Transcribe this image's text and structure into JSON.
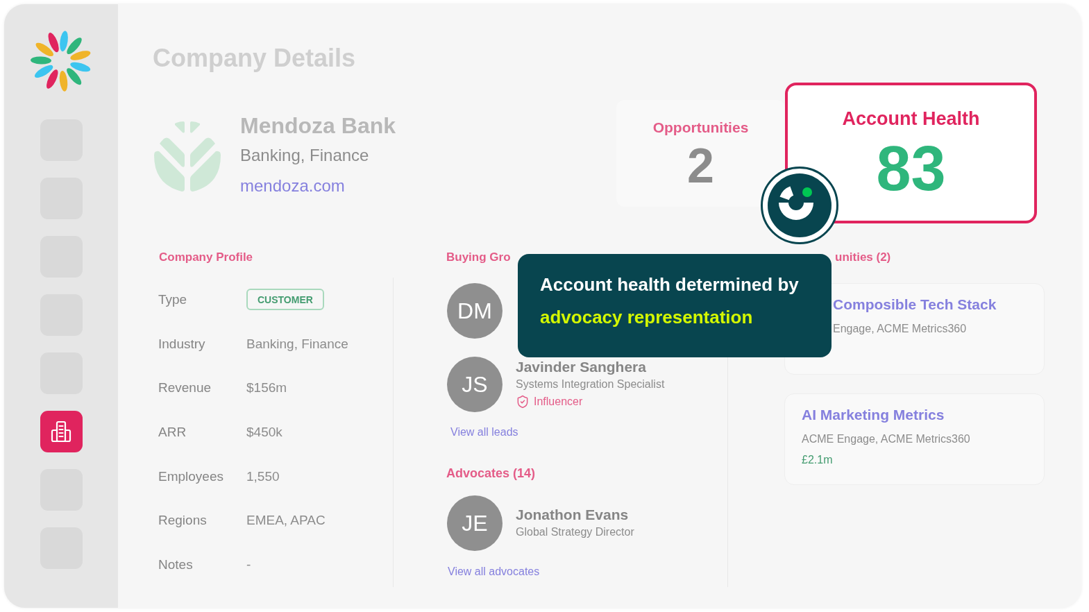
{
  "sidebar": {
    "items": [
      {
        "selected": false
      },
      {
        "selected": false
      },
      {
        "selected": false
      },
      {
        "selected": false
      },
      {
        "selected": false
      },
      {
        "selected": true
      },
      {
        "selected": false
      },
      {
        "selected": false
      }
    ]
  },
  "page_title": "Company Details",
  "header": {
    "company": {
      "name": "Mendoza Bank",
      "industry": "Banking, Finance",
      "website": "mendoza.com"
    },
    "opportunities": {
      "label": "Opportunities",
      "value": "2"
    },
    "account_health": {
      "label": "Account Health",
      "value": "83"
    }
  },
  "company_profile": {
    "title": "Company Profile",
    "rows": [
      {
        "label": "Type",
        "value": "CUSTOMER",
        "kind": "badge"
      },
      {
        "label": "Industry",
        "value": "Banking, Finance",
        "kind": "text"
      },
      {
        "label": "Revenue",
        "value": "$156m",
        "kind": "text"
      },
      {
        "label": "ARR",
        "value": "$450k",
        "kind": "text"
      },
      {
        "label": "Employees",
        "value": "1,550",
        "kind": "text"
      },
      {
        "label": "Regions",
        "value": "EMEA, APAC",
        "kind": "text"
      },
      {
        "label": "Notes",
        "value": "-",
        "kind": "text"
      }
    ]
  },
  "buying_group": {
    "title": "Buying Gro",
    "people": [
      {
        "initials": "DM"
      },
      {
        "initials": "JS",
        "name": "Javinder Sanghera",
        "title": "Systems Integration Specialist",
        "role": "Influencer"
      }
    ],
    "link": "View all leads"
  },
  "advocates": {
    "title": "Advocates (14)",
    "people": [
      {
        "initials": "JE",
        "name": "Jonathon Evans",
        "title": "Global Strategy Director"
      }
    ],
    "link": "View all advocates"
  },
  "opportunities": {
    "title": "unities (2)",
    "items": [
      {
        "name": "Composible Tech Stack",
        "products": "Engage, ACME Metrics360"
      },
      {
        "name": "AI Marketing Metrics",
        "products": "ACME Engage, ACME Metrics360",
        "value": "£2.1m"
      }
    ]
  },
  "tooltip": {
    "text": "Account health determined by",
    "highlight": "advocacy representation"
  }
}
